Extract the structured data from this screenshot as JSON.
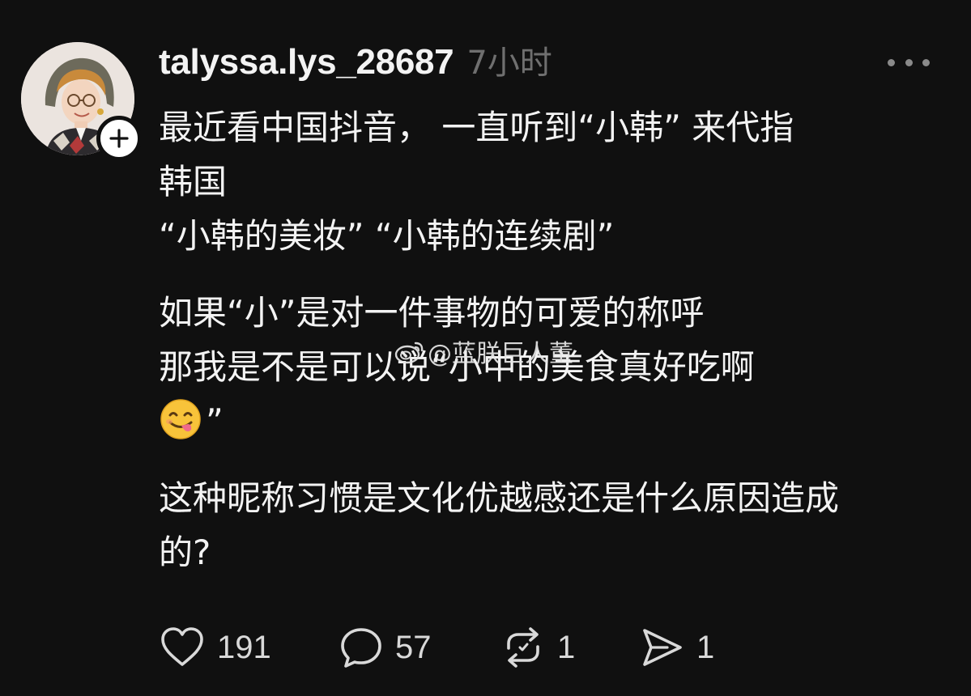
{
  "post": {
    "username": "talyssa.lys_28687",
    "time": "7小时",
    "paragraphs": [
      "最近看中国抖音， 一直听到“小韩” 来代指\n韩国\n“小韩的美妆” “小韩的连续剧”",
      "如果“小”是对一件事物的可爱的称呼\n那我是不是可以说“小中的美食真好吃啊",
      "这种昵称习惯是文化优越感还是什么原因造成\n的?"
    ],
    "emoji_line_suffix": "”",
    "emoji_name": "face-savoring-food-emoji"
  },
  "watermark": {
    "text": "@蓝朕巨人董",
    "icon": "weibo-logo-icon"
  },
  "actions": {
    "like_count": "191",
    "reply_count": "57",
    "repost_count": "1",
    "share_count": "1"
  },
  "icons": {
    "follow": "plus-icon",
    "more": "more-horizontal-icon",
    "like": "heart-icon",
    "reply": "comment-bubble-icon",
    "repost": "repost-icon",
    "share": "send-icon"
  },
  "colors": {
    "background": "#101010",
    "text": "#f3f3f3",
    "muted": "#6f6f6f",
    "icon": "#d9d9d9"
  }
}
